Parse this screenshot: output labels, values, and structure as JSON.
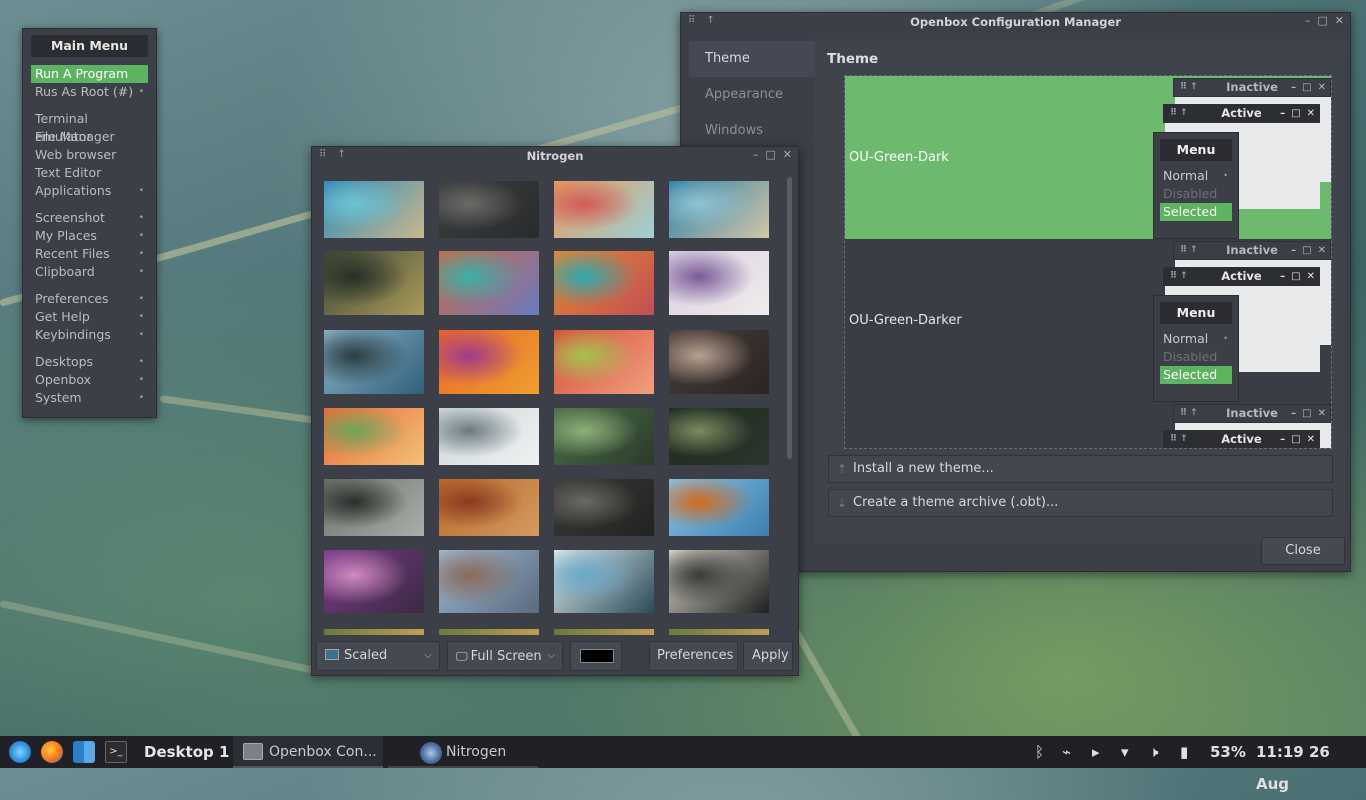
{
  "main_menu": {
    "title": "Main Menu",
    "groups": [
      [
        {
          "label": "Run A Program",
          "arrow": false,
          "active": true
        },
        {
          "label": "Rus As Root (#)",
          "arrow": true
        }
      ],
      [
        {
          "label": "Terminal emulator"
        },
        {
          "label": "File Manager"
        },
        {
          "label": "Web browser"
        },
        {
          "label": "Text Editor"
        },
        {
          "label": "Applications",
          "arrow": true
        }
      ],
      [
        {
          "label": "Screenshot",
          "arrow": true
        },
        {
          "label": "My Places",
          "arrow": true
        },
        {
          "label": "Recent Files",
          "arrow": true
        },
        {
          "label": "Clipboard",
          "arrow": true
        }
      ],
      [
        {
          "label": "Preferences",
          "arrow": true
        },
        {
          "label": "Get Help",
          "arrow": true
        },
        {
          "label": "Keybindings",
          "arrow": true
        }
      ],
      [
        {
          "label": "Desktops",
          "arrow": true
        },
        {
          "label": "Openbox",
          "arrow": true
        },
        {
          "label": "System",
          "arrow": true
        }
      ]
    ],
    "arrow_glyph": "•"
  },
  "nitrogen": {
    "title": "Nitrogen",
    "scale_mode": "Scaled",
    "monitor": "Full Screen",
    "color_swatch": "#000000",
    "preferences_label": "Preferences",
    "apply_label": "Apply",
    "thumbnails": [
      {
        "name": "thumb-sea-cliffs-aerial",
        "colors": [
          "#2e8ab5",
          "#6dc4d6",
          "#c9b78f"
        ]
      },
      {
        "name": "thumb-canyon-path",
        "colors": [
          "#3b3d3e",
          "#6b6a67",
          "#2a2b2c"
        ]
      },
      {
        "name": "thumb-autumn-leaf",
        "colors": [
          "#e79a5a",
          "#d25b58",
          "#9dd0d9"
        ]
      },
      {
        "name": "thumb-coastline",
        "colors": [
          "#2f7fa6",
          "#8fc3d3",
          "#d2c6a8"
        ]
      },
      {
        "name": "thumb-twig-buds",
        "colors": [
          "#3f4739",
          "#273028",
          "#aa9b5a"
        ]
      },
      {
        "name": "thumb-blur-rainbow",
        "colors": [
          "#c96a44",
          "#3bb0a8",
          "#6b7ac2"
        ]
      },
      {
        "name": "thumb-blur-orange-teal",
        "colors": [
          "#e28a2f",
          "#2ea8b0",
          "#c24d55"
        ]
      },
      {
        "name": "thumb-misty-mountain",
        "colors": [
          "#d9cfe0",
          "#7a5a9a",
          "#f0ecec"
        ]
      },
      {
        "name": "thumb-sea-rocks",
        "colors": [
          "#8db4c7",
          "#2c3d41",
          "#2f5f7b"
        ]
      },
      {
        "name": "thumb-abstract-orange",
        "colors": [
          "#e8642a",
          "#a03b8a",
          "#f0a030"
        ]
      },
      {
        "name": "thumb-tulips",
        "colors": [
          "#d84b3a",
          "#a6c24f",
          "#f0a080"
        ]
      },
      {
        "name": "thumb-dry-flower",
        "colors": [
          "#4a3e3a",
          "#b8a090",
          "#2a2424"
        ]
      },
      {
        "name": "thumb-orange-flowers",
        "colors": [
          "#e86a35",
          "#6ea35a",
          "#f2c07a"
        ]
      },
      {
        "name": "thumb-white-blossoms",
        "colors": [
          "#cfd6d8",
          "#6b7a80",
          "#eef2f2"
        ]
      },
      {
        "name": "thumb-green-plant",
        "colors": [
          "#4d6e4a",
          "#8fb07a",
          "#2b3b2b"
        ]
      },
      {
        "name": "thumb-dark-leaf",
        "colors": [
          "#1f2a20",
          "#7a8a60",
          "#2b352b"
        ]
      },
      {
        "name": "thumb-bw-branches",
        "colors": [
          "#6b716b",
          "#2b2e2b",
          "#a9b0a9"
        ]
      },
      {
        "name": "thumb-autumn-leaves",
        "colors": [
          "#b86a2a",
          "#8a3a20",
          "#d49a60"
        ]
      },
      {
        "name": "thumb-dark-rock",
        "colors": [
          "#3a3a38",
          "#6a6864",
          "#222220"
        ]
      },
      {
        "name": "thumb-leaf-sky",
        "colors": [
          "#8cc2e0",
          "#d06a20",
          "#3a7fb0"
        ]
      },
      {
        "name": "thumb-purple-flowers",
        "colors": [
          "#7a3a8a",
          "#d08ac0",
          "#3a2a40"
        ]
      },
      {
        "name": "thumb-mountain-range",
        "colors": [
          "#a0b8d0",
          "#8a6a5a",
          "#5a6a80"
        ]
      },
      {
        "name": "thumb-tower-sky",
        "colors": [
          "#dfe9ec",
          "#6aa8c8",
          "#2a4a5a"
        ]
      },
      {
        "name": "thumb-sunset-road",
        "colors": [
          "#dad6cc",
          "#3a3a38",
          "#1e1e1e"
        ]
      }
    ]
  },
  "obconf": {
    "title": "Openbox Configuration Manager",
    "tabs": [
      {
        "label": "Theme",
        "active": true
      },
      {
        "label": "Appearance"
      },
      {
        "label": "Windows"
      }
    ],
    "heading": "Theme",
    "themes": [
      {
        "name": "OU-Green-Dark",
        "selected": true
      },
      {
        "name": "OU-Green-Darker",
        "selected": false
      }
    ],
    "preview": {
      "inactive": "Inactive",
      "active": "Active",
      "menu_title": "Menu",
      "normal": "Normal",
      "disabled": "Disabled",
      "selected": "Selected"
    },
    "install_label": "Install a new theme...",
    "archive_label": "Create a theme archive (.obt)...",
    "close_label": "Close",
    "accent_color": "#6dba6e"
  },
  "taskbar": {
    "desktop": "Desktop 1",
    "tasks": [
      {
        "label": "Openbox Con..."
      },
      {
        "label": "Nitrogen"
      }
    ],
    "battery": "53%",
    "clock": "11:19 26 Aug"
  }
}
